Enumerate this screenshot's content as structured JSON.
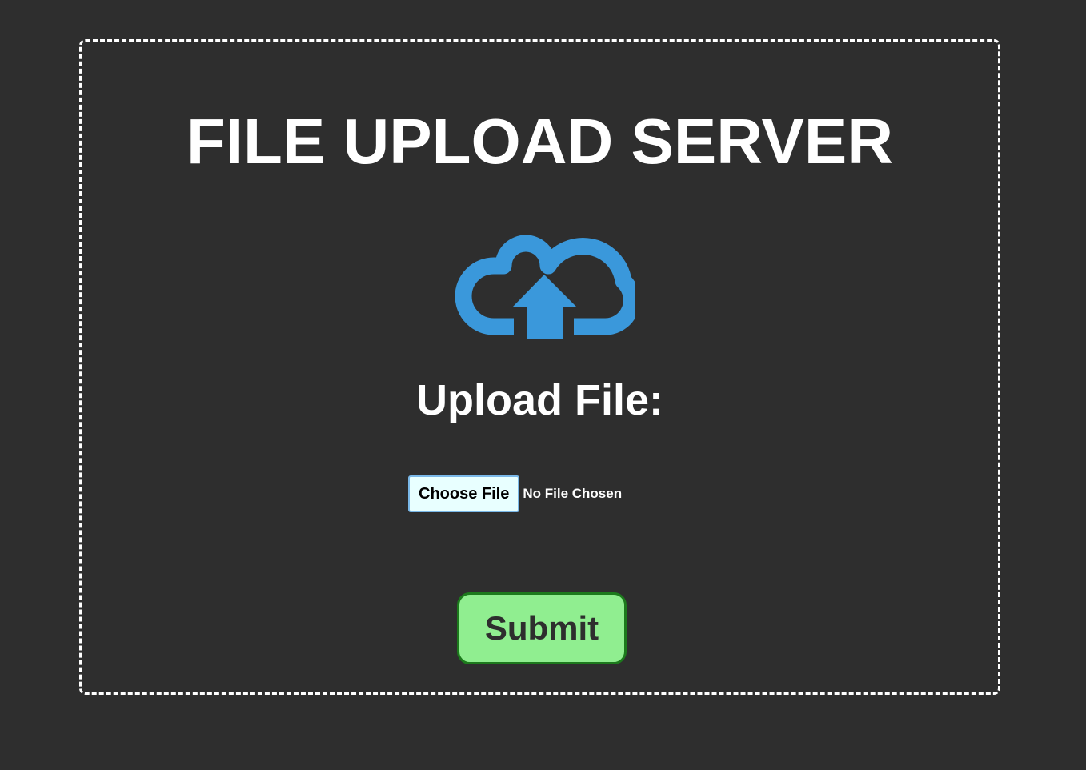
{
  "title": "FILE UPLOAD SERVER",
  "upload_label": "Upload File:",
  "file_input": {
    "button_label": "Choose File",
    "status_text": "No File Chosen"
  },
  "submit_label": "Submit",
  "icons": {
    "upload": "cloud-upload-icon"
  },
  "colors": {
    "background": "#2e2e2e",
    "icon": "#3a98db",
    "submit_fill": "#90ee90",
    "submit_border": "#1c7a1c",
    "choose_file_fill": "#e8ffff"
  }
}
